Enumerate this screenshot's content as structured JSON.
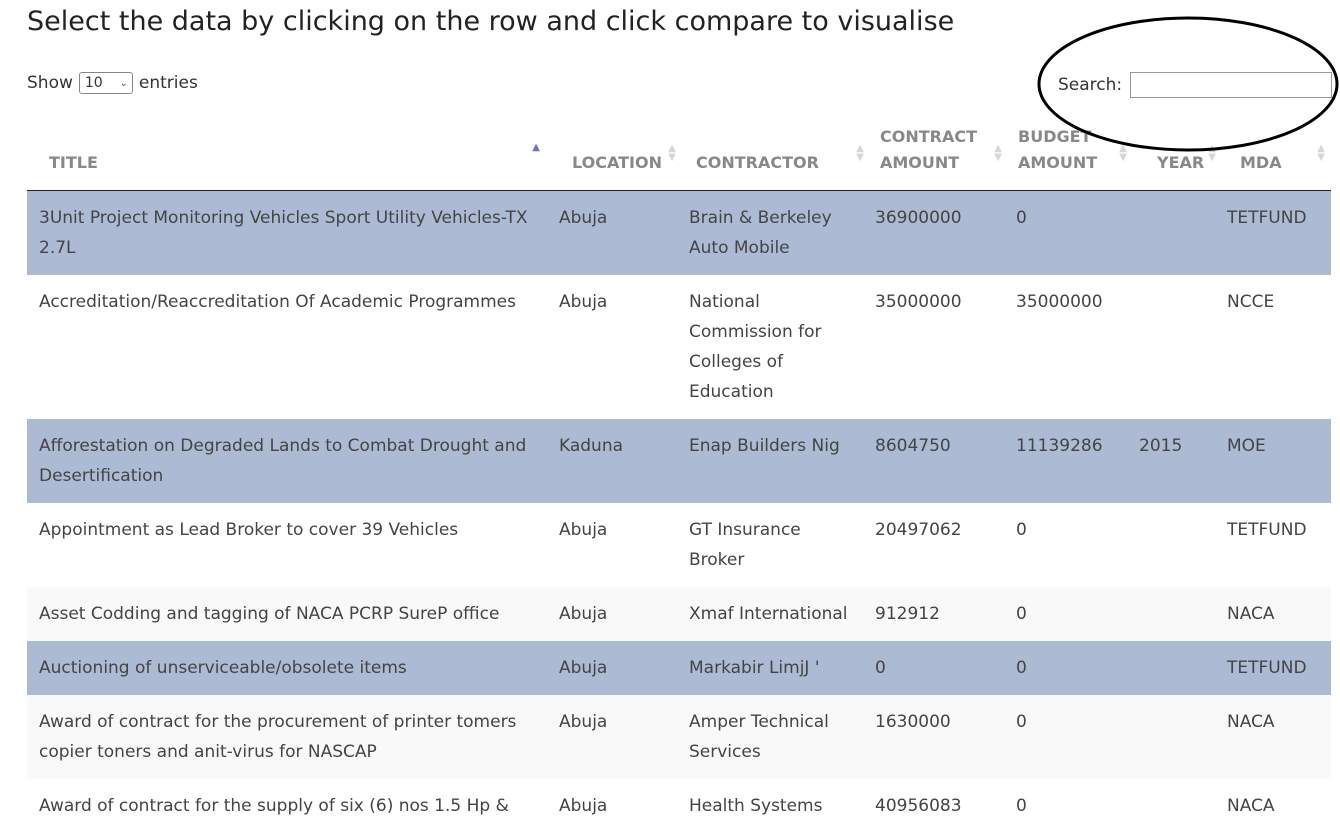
{
  "page": {
    "title": "Select the data by clicking on the row and click compare to visualise"
  },
  "length_control": {
    "prefix": "Show",
    "value": "10",
    "suffix": "entries"
  },
  "search": {
    "label": "Search:",
    "value": ""
  },
  "columns": [
    {
      "label": "TITLE",
      "sort": "asc"
    },
    {
      "label": "LOCATION",
      "sort": "none"
    },
    {
      "label": "CONTRACTOR",
      "sort": "none"
    },
    {
      "label": "CONTRACT AMOUNT",
      "sort": "none"
    },
    {
      "label": "BUDGET AMOUNT",
      "sort": "none"
    },
    {
      "label": "YEAR",
      "sort": "none"
    },
    {
      "label": "MDA",
      "sort": "none"
    }
  ],
  "rows": [
    {
      "selected": true,
      "cells": [
        "3Unit Project Monitoring Vehicles Sport Utility Vehicles-TX 2.7L",
        "Abuja",
        "Brain & Berkeley Auto Mobile",
        "36900000",
        "0",
        "",
        "TETFUND"
      ]
    },
    {
      "selected": false,
      "cells": [
        "Accreditation/Reaccreditation Of Academic Programmes",
        "Abuja",
        "National Commission for Colleges of Education",
        "35000000",
        "35000000",
        "",
        "NCCE"
      ]
    },
    {
      "selected": true,
      "cells": [
        "Afforestation on Degraded Lands to Combat Drought and Desertification",
        "Kaduna",
        "Enap Builders Nig",
        "8604750",
        "11139286",
        "2015",
        "MOE"
      ]
    },
    {
      "selected": false,
      "cells": [
        "Appointment as Lead Broker to cover 39 Vehicles",
        "Abuja",
        "GT Insurance Broker",
        "20497062",
        "0",
        "",
        "TETFUND"
      ]
    },
    {
      "selected": false,
      "cells": [
        "Asset Codding and tagging of NACA PCRP SureP office",
        "Abuja",
        "Xmaf International",
        "912912",
        "0",
        "",
        "NACA"
      ]
    },
    {
      "selected": true,
      "cells": [
        "Auctioning of unserviceable/obsolete items",
        "Abuja",
        "Markabir LimjJ '",
        "0",
        "0",
        "",
        "TETFUND"
      ]
    },
    {
      "selected": false,
      "cells": [
        "Award of contract for the procurement of printer tomers copier toners and anit-virus for NASCAP",
        "Abuja",
        "Amper Technical Services",
        "1630000",
        "0",
        "",
        "NACA"
      ]
    },
    {
      "selected": false,
      "cells": [
        "Award of contract for the supply of six (6) nos 1.5 Hp &",
        "Abuja",
        "Health Systems",
        "40956083",
        "0",
        "",
        "NACA"
      ]
    }
  ]
}
